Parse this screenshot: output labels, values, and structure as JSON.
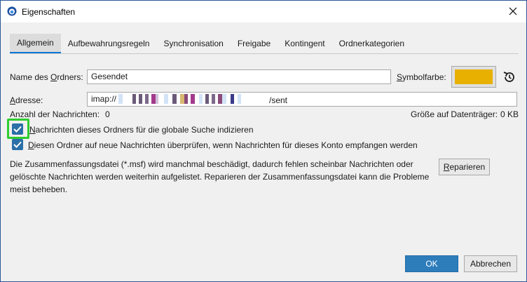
{
  "window": {
    "title": "Eigenschaften"
  },
  "tabs": [
    {
      "label": "Allgemein",
      "active": true
    },
    {
      "label": "Aufbewahrungsregeln",
      "active": false
    },
    {
      "label": "Synchronisation",
      "active": false
    },
    {
      "label": "Freigabe",
      "active": false
    },
    {
      "label": "Kontingent",
      "active": false
    },
    {
      "label": "Ordnerkategorien",
      "active": false
    }
  ],
  "folder": {
    "name_label_pre": "Name des ",
    "name_label_u": "O",
    "name_label_post": "rdners:",
    "name_value": "Gesendet",
    "color_label_u": "S",
    "color_label_post": "ymbolfarbe:",
    "color_value": "#e8b000",
    "address_label_u": "A",
    "address_label_post": "dresse:",
    "address_prefix": "imap://",
    "address_suffix": "/sent",
    "message_count_label": "Anzahl der Nachrichten:",
    "message_count_value": "0",
    "size_label": "Größe auf Datenträger:",
    "size_value": "0 KB"
  },
  "options": {
    "index_label_u": "N",
    "index_label_post": "achrichten dieses Ordners für die globale Suche indizieren",
    "index_checked": true,
    "check_label_u": "D",
    "check_label_post": "iesen Ordner auf neue Nachrichten überprüfen, wenn Nachrichten für dieses Konto empfangen werden",
    "check_checked": true
  },
  "repair": {
    "description": "Die Zusammenfassungsdatei (*.msf) wird manchmal beschädigt, dadurch fehlen scheinbar Nachrichten oder gelöschte Nachrichten werden weiterhin aufgelistet. Reparieren der Zusammenfassungsdatei kann die Probleme meist beheben.",
    "button_u": "R",
    "button_post": "eparieren"
  },
  "footer": {
    "ok_label": "OK",
    "cancel_label": "Abbrechen"
  },
  "colors": {
    "accent": "#2e7dbb",
    "checkbox": "#2a6fa8",
    "highlight": "#2ecc2e"
  }
}
